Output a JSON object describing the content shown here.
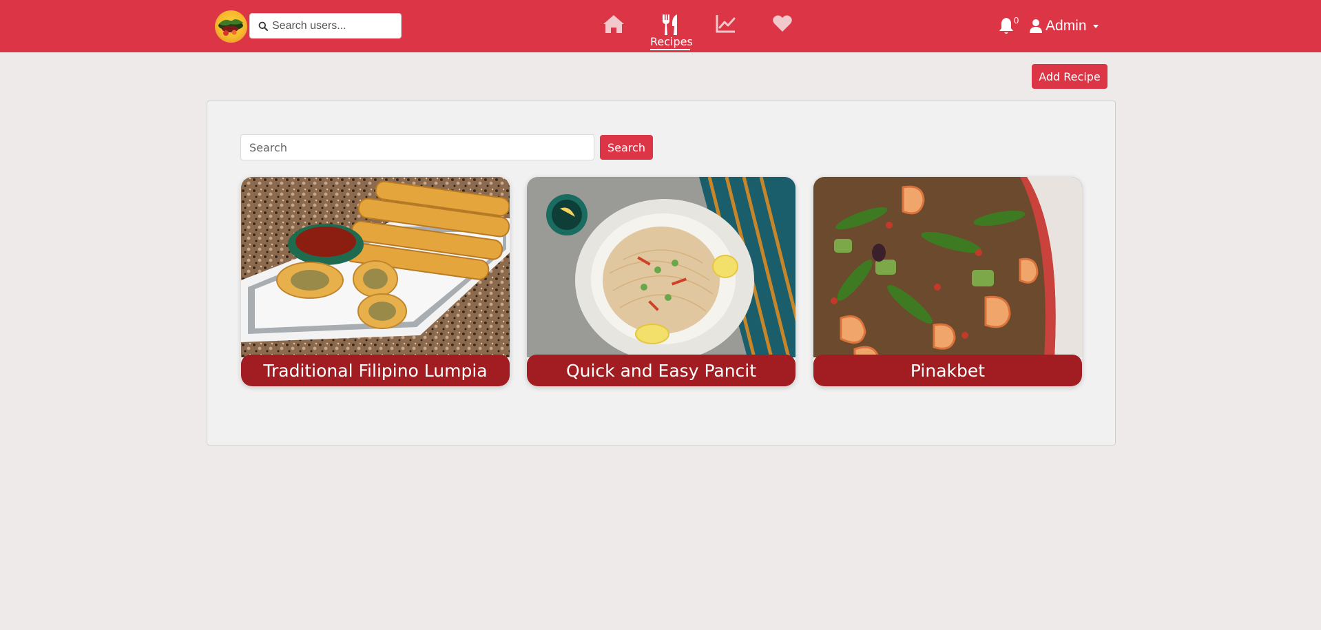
{
  "header": {
    "logo_icon": "filipino-food-logo",
    "user_search": {
      "placeholder": "Search users...",
      "icon": "search-icon"
    },
    "nav": [
      {
        "name": "home",
        "icon": "home-icon",
        "label": ""
      },
      {
        "name": "recipes",
        "icon": "utensils-icon",
        "label": "Recipes",
        "active": true
      },
      {
        "name": "stats",
        "icon": "chart-line-icon",
        "label": ""
      },
      {
        "name": "favorites",
        "icon": "heart-icon",
        "label": ""
      }
    ],
    "notifications": {
      "icon": "bell-icon",
      "count": "0"
    },
    "user": {
      "icon": "user-icon",
      "name": "Admin"
    }
  },
  "toolbar": {
    "add_recipe_label": "Add Recipe"
  },
  "main": {
    "search": {
      "placeholder": "Search",
      "button_label": "Search"
    },
    "recipes": [
      {
        "title": "Traditional Filipino Lumpia"
      },
      {
        "title": "Quick and Easy Pancit"
      },
      {
        "title": "Pinakbet"
      }
    ]
  },
  "colors": {
    "brand": "#dc3545",
    "card_title_bg": "#a11d21",
    "page_bg": "#eeeaea",
    "panel_bg": "#f2f1f1"
  }
}
